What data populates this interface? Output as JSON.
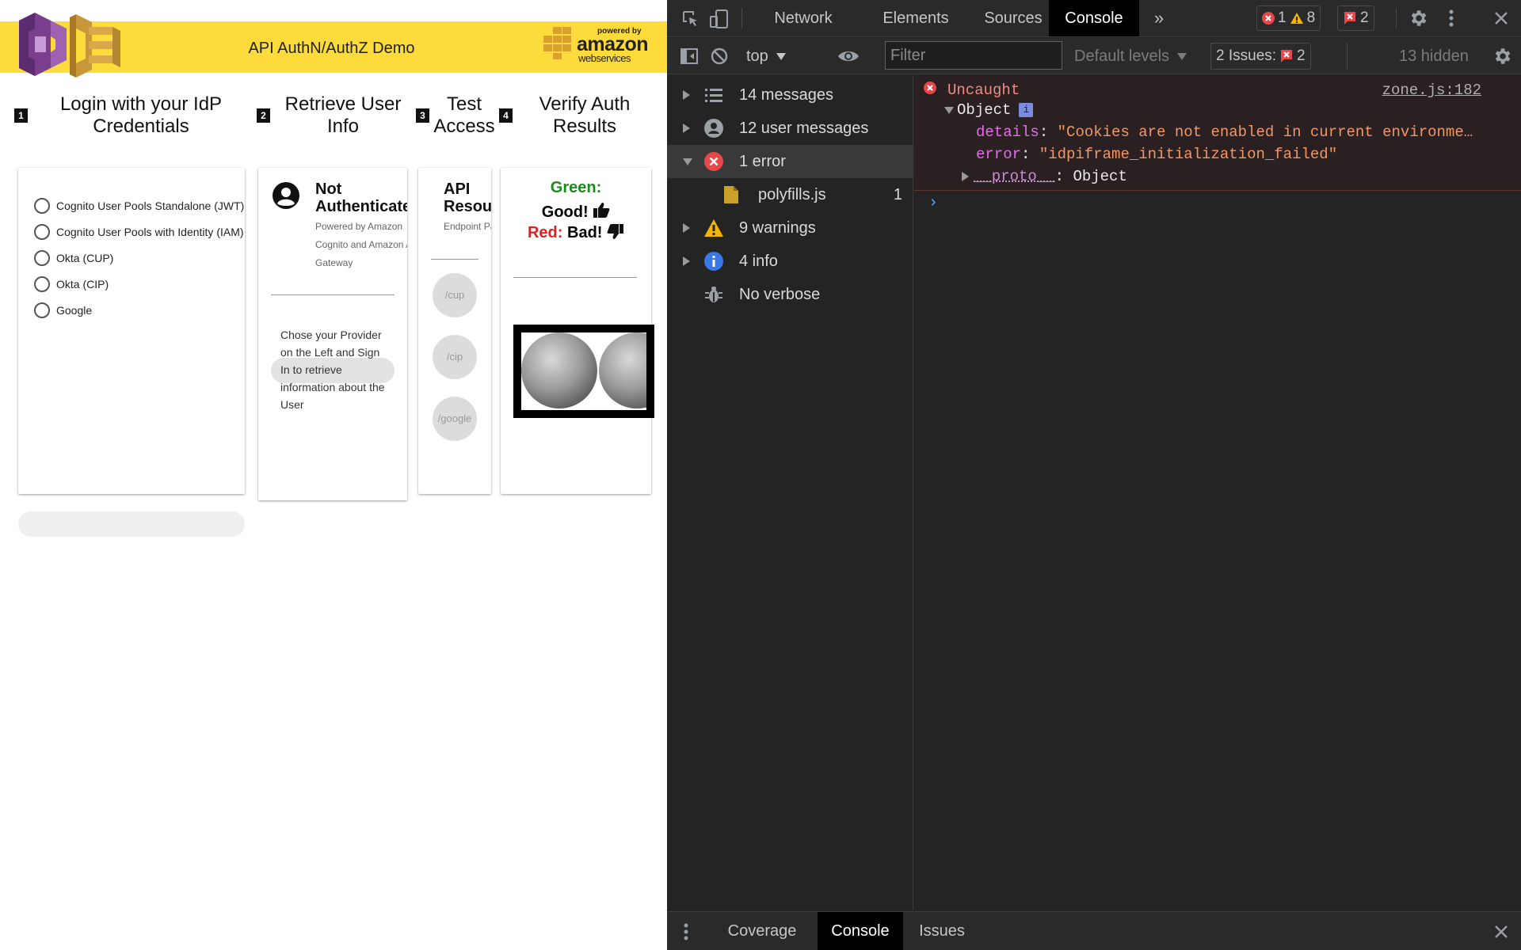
{
  "app": {
    "title": "API AuthN/AuthZ Demo",
    "aws_logo": {
      "powered_by": "powered by",
      "amazon": "amazon",
      "web_services": "webservices"
    },
    "steps": [
      {
        "number": "1",
        "title_line1": "Login with your IdP",
        "title_line2": "Credentials"
      },
      {
        "number": "2",
        "title_line1": "Retrieve User",
        "title_line2": "Info"
      },
      {
        "number": "3",
        "title_line1": "Test",
        "title_line2": "Access"
      },
      {
        "number": "4",
        "title_line1": "Verify Auth",
        "title_line2": "Results"
      }
    ],
    "providers": [
      "Cognito User Pools Standalone (JWT)",
      "Cognito User Pools with Identity (IAM)",
      "Okta (CUP)",
      "Okta (CIP)",
      "Google"
    ],
    "user_card": {
      "title_line1": "Not",
      "title_line2": "Authenticate",
      "sub_lines": [
        "Powered by Amazon",
        "Cognito and Amazon AP",
        "Gateway"
      ],
      "hint_lines": [
        "Chose your Provider",
        "on the Left and Sign",
        "In to retrieve",
        "information about the",
        "User"
      ]
    },
    "api_card": {
      "title_line1": "API",
      "title_line2": "Resou",
      "sub": "Endpoint Pa",
      "endpoints": [
        "/cup",
        "/cip",
        "/google"
      ]
    },
    "verify_card": {
      "green_label": "Green:",
      "good": "Good!",
      "red_label": "Red:",
      "bad": "Bad!"
    }
  },
  "devtools": {
    "tabs": [
      "Network",
      "Elements",
      "Sources",
      "Console"
    ],
    "active_tab": "Console",
    "counts": {
      "errors": "1",
      "warnings": "8",
      "issues": "2"
    },
    "toolbar": {
      "context": "top",
      "filter_placeholder": "Filter",
      "levels": "Default levels",
      "issues_label": "2 Issues:",
      "issues_count": "2",
      "hidden": "13 hidden"
    },
    "sidebar": [
      {
        "label": "14 messages",
        "icon": "list-icon",
        "count": ""
      },
      {
        "label": "12 user messages",
        "icon": "user-circle-icon",
        "count": ""
      },
      {
        "label": "1 error",
        "icon": "error-icon",
        "count": ""
      },
      {
        "label": "polyfills.js",
        "icon": "file-icon",
        "count": "1"
      },
      {
        "label": "9 warnings",
        "icon": "warning-icon",
        "count": ""
      },
      {
        "label": "4 info",
        "icon": "info-icon",
        "count": ""
      },
      {
        "label": "No verbose",
        "icon": "bug-icon",
        "count": ""
      }
    ],
    "console": {
      "error_title": "Uncaught",
      "source_link": "zone.js:182",
      "object_label": "Object",
      "details_key": "details",
      "details_value": "\"Cookies are not enabled in current environme…",
      "error_key": "error",
      "error_value": "\"idpiframe_initialization_failed\"",
      "proto_key": "__proto__",
      "proto_value": "Object"
    },
    "bottom_tabs": [
      "Coverage",
      "Console",
      "Issues"
    ],
    "bottom_active": "Console"
  },
  "colors": {
    "header_yellow": "#fddb3a",
    "error_red": "#f28b82",
    "green": "#1e8a1e",
    "red": "#e02020"
  }
}
